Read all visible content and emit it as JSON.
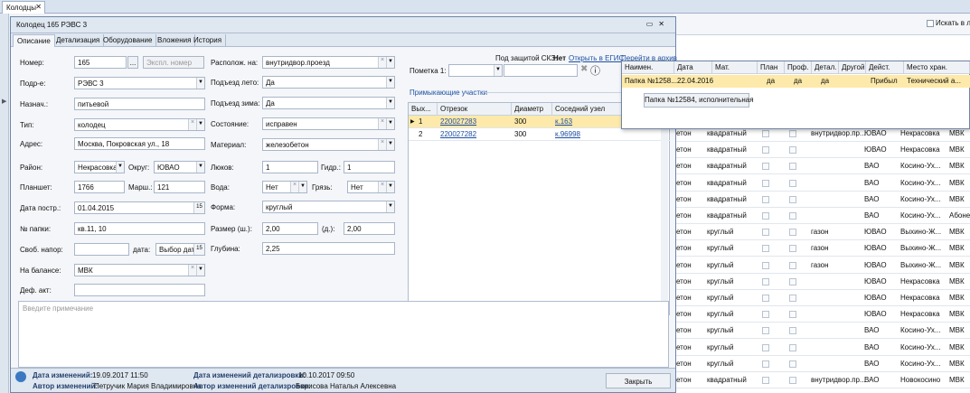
{
  "doc_tab": {
    "label": "Колодцы",
    "close": "✕"
  },
  "bg": {
    "search_in_list": "Искать в ли",
    "rows": [
      {
        "a": "етон",
        "b": "квадратный",
        "c": "внутридвор.пр...",
        "d": "ЮВАО",
        "e": "Некрасовка",
        "f": "МВК"
      },
      {
        "a": "етон",
        "b": "квадратный",
        "c": "",
        "d": "ЮВАО",
        "e": "Некрасовка",
        "f": "МВК"
      },
      {
        "a": "етон",
        "b": "квадратный",
        "c": "",
        "d": "ВАО",
        "e": "Косино-Ух...",
        "f": "МВК"
      },
      {
        "a": "етон",
        "b": "квадратный",
        "c": "",
        "d": "ВАО",
        "e": "Косино-Ух...",
        "f": "МВК"
      },
      {
        "a": "етон",
        "b": "квадратный",
        "c": "",
        "d": "ВАО",
        "e": "Косино-Ух...",
        "f": "МВК"
      },
      {
        "a": "етон",
        "b": "квадратный",
        "c": "",
        "d": "ВАО",
        "e": "Косино-Ух...",
        "f": "Абоне"
      },
      {
        "a": "етон",
        "b": "круглый",
        "c": "газон",
        "d": "ЮВАО",
        "e": "Выхино-Ж...",
        "f": "МВК"
      },
      {
        "a": "етон",
        "b": "круглый",
        "c": "газон",
        "d": "ЮВАО",
        "e": "Выхино-Ж...",
        "f": "МВК"
      },
      {
        "a": "етон",
        "b": "круглый",
        "c": "газон",
        "d": "ЮВАО",
        "e": "Выхино-Ж...",
        "f": "МВК"
      },
      {
        "a": "етон",
        "b": "круглый",
        "c": "",
        "d": "ЮВАО",
        "e": "Некрасовка",
        "f": "МВК"
      },
      {
        "a": "етон",
        "b": "круглый",
        "c": "",
        "d": "ЮВАО",
        "e": "Некрасовка",
        "f": "МВК"
      },
      {
        "a": "етон",
        "b": "круглый",
        "c": "",
        "d": "ЮВАО",
        "e": "Некрасовка",
        "f": "МВК"
      },
      {
        "a": "етон",
        "b": "круглый",
        "c": "",
        "d": "ВАО",
        "e": "Косино-Ух...",
        "f": "МВК"
      },
      {
        "a": "етон",
        "b": "круглый",
        "c": "",
        "d": "ВАО",
        "e": "Косино-Ух...",
        "f": "МВК"
      },
      {
        "a": "етон",
        "b": "круглый",
        "c": "",
        "d": "ВАО",
        "e": "Косино-Ух...",
        "f": "МВК"
      },
      {
        "a": "етон",
        "b": "квадратный",
        "c": "внутридвор.пр...",
        "d": "ВАО",
        "e": "Новокосино",
        "f": "МВК"
      }
    ]
  },
  "dialog": {
    "title": "Колодец 165 РЭВС 3",
    "tabs": [
      "Описание",
      "Детализация",
      "Оборудование",
      "Вложения",
      "История"
    ],
    "left": {
      "nomer_label": "Номер:",
      "nomer_value": "165",
      "nomer_btn": "...",
      "expl_placeholder": "Экспл. номер",
      "podr_label": "Подр-е:",
      "podr_value": "РЭВС 3",
      "naznach_label": "Назнач.:",
      "naznach_value": "питьевой",
      "tip_label": "Тип:",
      "tip_value": "колодец",
      "adres_label": "Адрес:",
      "adres_value": "Москва, Покровская ул., 18",
      "raion_label": "Район:",
      "raion_value": "Некрасовка",
      "okrug_label": "Округ:",
      "okrug_value": "ЮВАО",
      "planshet_label": "Планшет:",
      "planshet_value": "1766",
      "marsh_label": "Марш.:",
      "marsh_value": "121",
      "data_label": "Дата постр.:",
      "data_value": "01.04.2015",
      "papka_label": "№ папки:",
      "papka_value": "кв.11, 10",
      "napor_label": "Своб. напор:",
      "napor_date_label": "дата:",
      "napor_date_value": "Выбор дат",
      "balance_label": "На балансе:",
      "balance_value": "МВК",
      "defakt_label": "Деф. акт:",
      "cal_icon": "15"
    },
    "mid": {
      "raspol_label": "Располож. на:",
      "raspol_value": "внутридвор.проезд",
      "leto_label": "Подъезд лето:",
      "leto_value": "Да",
      "zima_label": "Подъезд зима:",
      "zima_value": "Да",
      "sost_label": "Состояние:",
      "sost_value": "исправен",
      "mat_label": "Материал:",
      "mat_value": "железобетон",
      "lukov_label": "Люков:",
      "lukov_value": "1",
      "gidr_label": "Гидр.:",
      "gidr_value": "1",
      "voda_label": "Вода:",
      "voda_value": "Нет",
      "gryazi_label": "Грязь:",
      "gryazi_value": "Нет",
      "forma_label": "Форма:",
      "forma_value": "круглый",
      "razmer_label": "Размер (ш.):",
      "razmer_w": "2,00",
      "razmer_d_label": "(д.):",
      "razmer_d": "2,00",
      "glubina_label": "Глубина:",
      "glubina_value": "2,25"
    },
    "right": {
      "skz_label": "Под защитой СКЗ:",
      "skz_value": "Нет",
      "open_egis": "Открыть в ЕГИС",
      "go_archive": "Перейти в архив",
      "pometka_label": "Пометка 1:",
      "info_icon": "ⓘ",
      "section_title": "Примыкающие участки",
      "headers": [
        "Вых...",
        "Отрезок",
        "Диаметр",
        "Соседний узел"
      ],
      "rows": [
        {
          "n": "1",
          "seg": "220027283",
          "diam": "300",
          "node": "к.163"
        },
        {
          "n": "2",
          "seg": "220027282",
          "diam": "300",
          "node": "к.96998"
        }
      ]
    },
    "note_placeholder": "Введите примечание",
    "footer": {
      "changed_label": "Дата изменений:",
      "changed_value": "19.09.2017 11:50",
      "author_label": "Автор изменений:",
      "author_value": "Петручик Мария Владимировна",
      "det_changed_label": "Дата изменений детализровки:",
      "det_changed_value": "10.10.2017 09:50",
      "det_author_label": "Автор изменений детализровки:",
      "det_author_value": "Борисова Наталья Алексевна",
      "close_button": "Закрыть"
    }
  },
  "popup": {
    "headers": [
      "Наимен.",
      "Дата",
      "Мат.",
      "План",
      "Проф.",
      "Детал.",
      "Другой",
      "Дейст.",
      "Место хран."
    ],
    "row": {
      "name": "Папка №1258...",
      "date": "22.04.2016",
      "mat": "",
      "plan": "да",
      "prof": "да",
      "detal": "да",
      "other": "",
      "act": "Прибыл",
      "place": "Технический а..."
    },
    "tooltip": "Папка №12584, исполнительная"
  },
  "colors": {
    "accent": "#1d4fa3",
    "selected_row": "#fde9a9",
    "title_bar": "#dfe7f1"
  }
}
